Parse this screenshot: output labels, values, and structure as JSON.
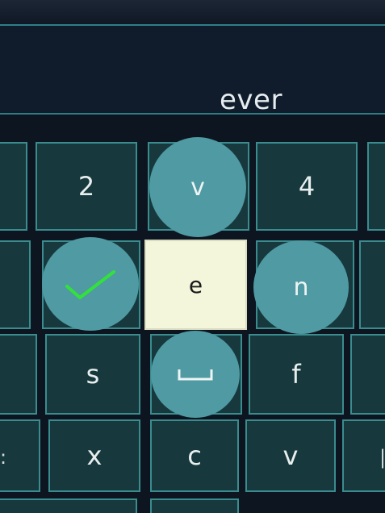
{
  "input": {
    "text": "ever"
  },
  "keys": {
    "row1": [
      "2",
      "",
      "4"
    ],
    "row3": [
      "s",
      "f"
    ],
    "row4": [
      "x",
      "c",
      "v"
    ]
  },
  "focused": {
    "letter": "e"
  },
  "bubbles": {
    "up": "v",
    "right": "n",
    "down_icon": "space-bar-icon",
    "left_icon": "check-icon"
  },
  "colors": {
    "key_bg": "#17393d",
    "key_border": "#3a8c8e",
    "bubble": "#4f9aa3",
    "focus_bg": "#f4f6dc",
    "check": "#33e13c"
  }
}
